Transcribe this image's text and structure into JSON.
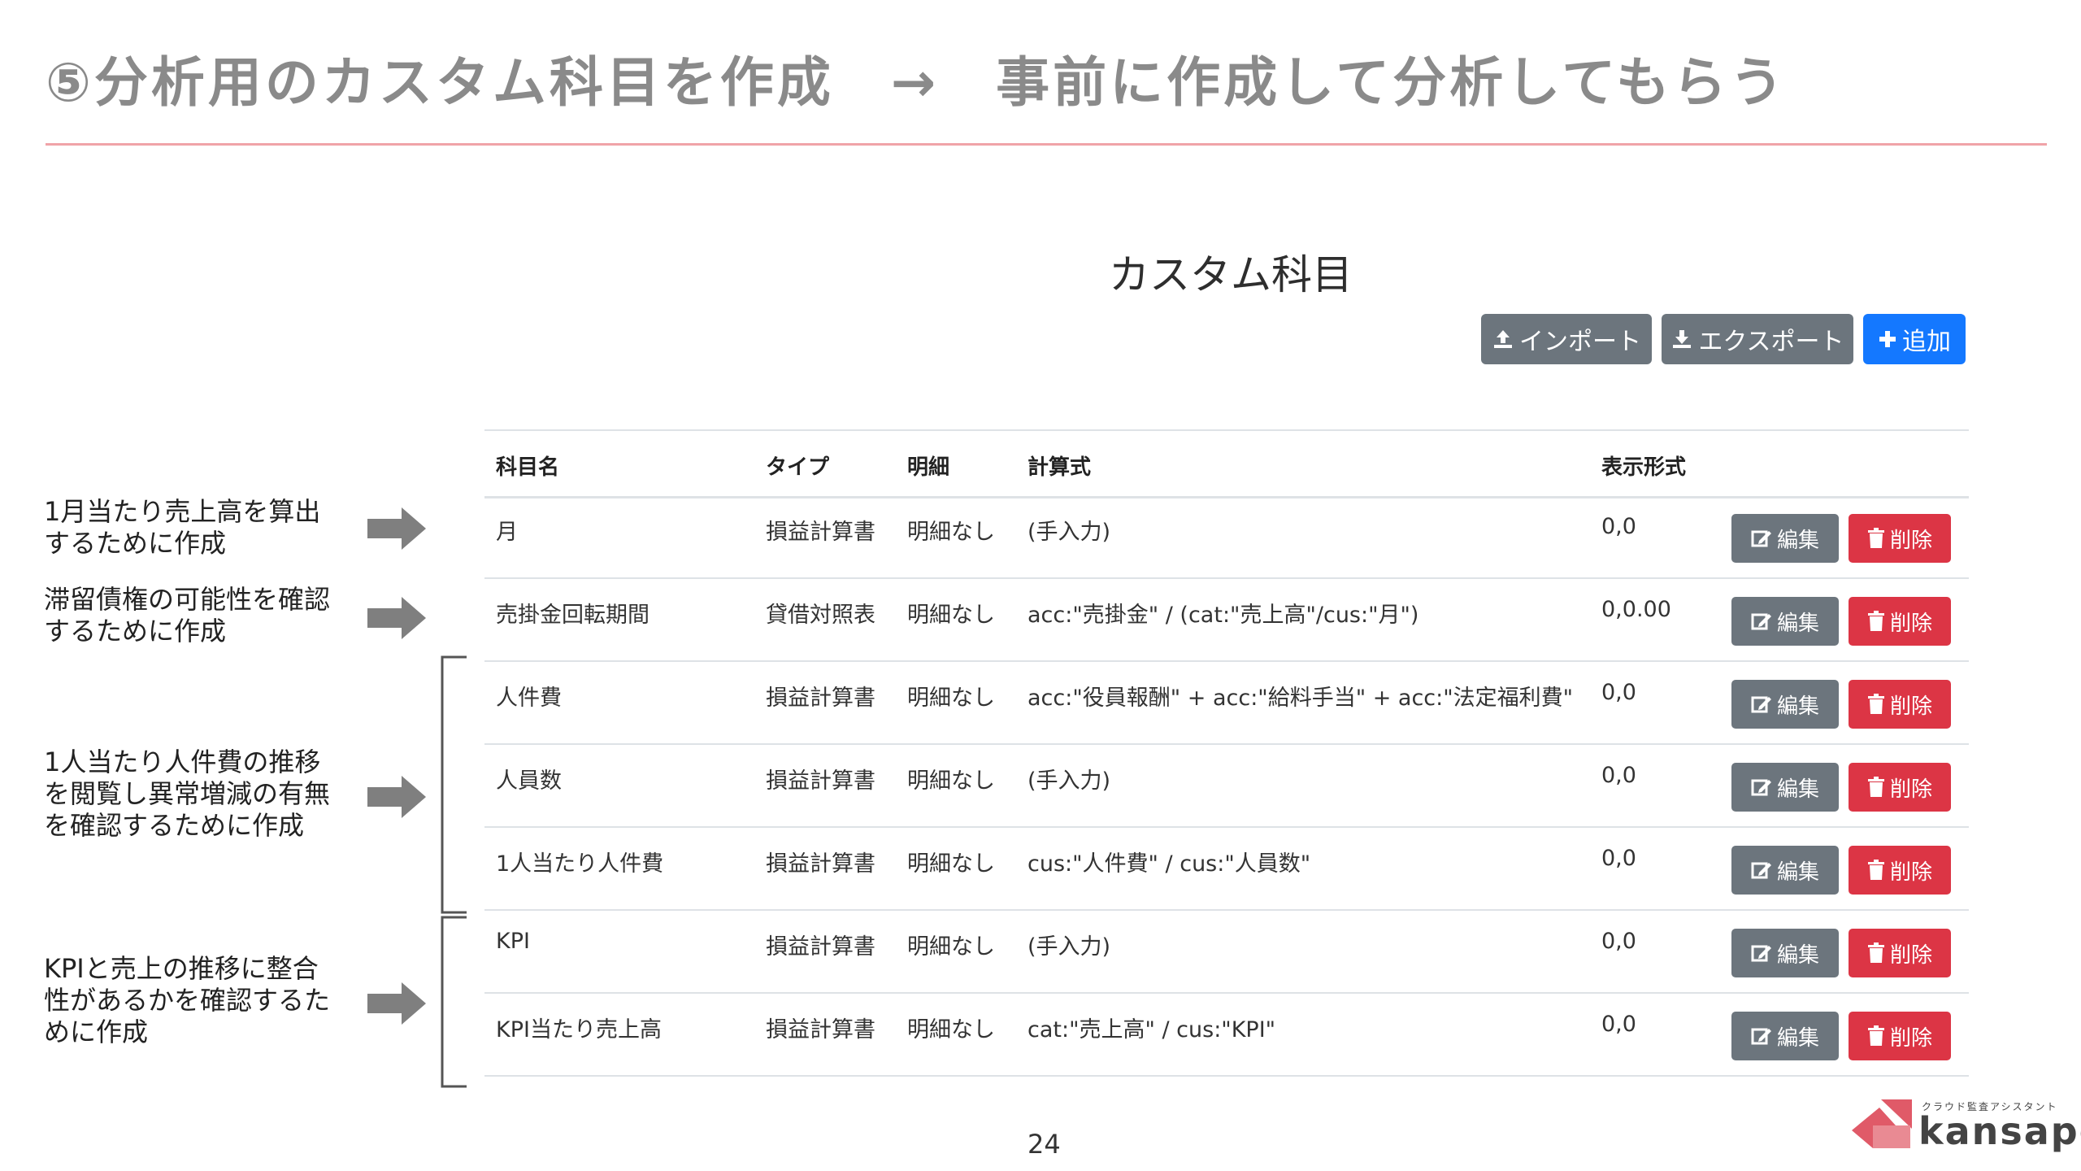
{
  "slide": {
    "title": "⑤分析用のカスタム科目を作成　→　事前に作成して分析してもらう",
    "page_number": "24"
  },
  "panel": {
    "title": "カスタム科目",
    "buttons": {
      "import_label": "インポート",
      "export_label": "エクスポート",
      "add_label": "追加"
    },
    "columns": [
      "科目名",
      "タイプ",
      "明細",
      "計算式",
      "表示形式"
    ],
    "rows": [
      {
        "name": "月",
        "type": "損益計算書",
        "detail": "明細なし",
        "formula": "(手入力)",
        "format": "0,0"
      },
      {
        "name": "売掛金回転期間",
        "type": "貸借対照表",
        "detail": "明細なし",
        "formula": "acc:\"売掛金\" / (cat:\"売上高\"/cus:\"月\")",
        "format": "0,0.00"
      },
      {
        "name": "人件費",
        "type": "損益計算書",
        "detail": "明細なし",
        "formula": "acc:\"役員報酬\" + acc:\"給料手当\" + acc:\"法定福利費\"",
        "format": "0,0"
      },
      {
        "name": "人員数",
        "type": "損益計算書",
        "detail": "明細なし",
        "formula": "(手入力)",
        "format": "0,0"
      },
      {
        "name": "1人当たり人件費",
        "type": "損益計算書",
        "detail": "明細なし",
        "formula": "cus:\"人件費\" / cus:\"人員数\"",
        "format": "0,0"
      },
      {
        "name": "KPI",
        "type": "損益計算書",
        "detail": "明細なし",
        "formula": "(手入力)",
        "format": "0,0"
      },
      {
        "name": "KPI当たり売上高",
        "type": "損益計算書",
        "detail": "明細なし",
        "formula": "cat:\"売上高\" / cus:\"KPI\"",
        "format": "0,0"
      }
    ],
    "row_actions": {
      "edit_label": "編集",
      "delete_label": "削除"
    }
  },
  "annotations": [
    {
      "text": "1月当たり売上高を算出\nするために作成"
    },
    {
      "text": "滞留債権の可能性を確認\nするために作成"
    },
    {
      "text": "1人当たり人件費の推移\nを閲覧し異常増減の有無\nを確認するために作成"
    },
    {
      "text": "KPIと売上の推移に整合\n性があるかを確認するた\nめに作成"
    }
  ],
  "logo": {
    "tagline": "クラウド監査アシスタント",
    "name": "kansapo"
  },
  "colors": {
    "title_gray": "#8a8a8a",
    "rule_pink": "#f0a3a8",
    "button_gray": "#6c757d",
    "button_blue": "#1478ff",
    "button_red": "#dc3545",
    "logo_red": "#e05a68"
  },
  "icons": {
    "import": "upload-icon",
    "export": "download-icon",
    "add": "plus-icon",
    "edit": "edit-icon",
    "delete": "trash-icon",
    "annotation": "arrow-right-icon"
  }
}
